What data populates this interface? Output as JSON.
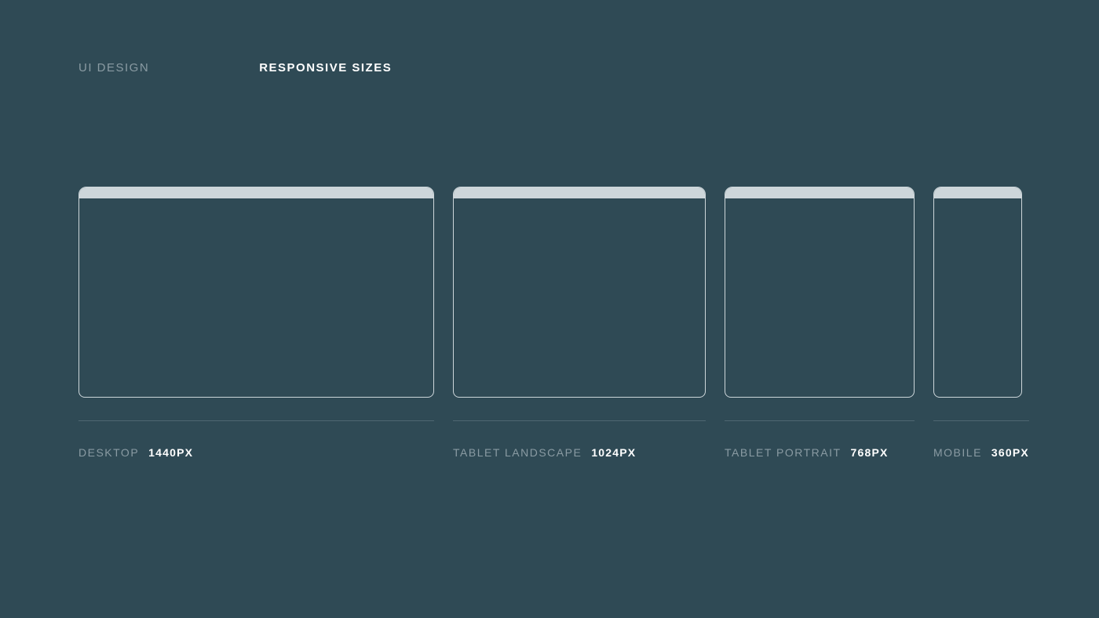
{
  "header": {
    "section": "UI DESIGN",
    "title": "RESPONSIVE SIZES"
  },
  "frames": [
    {
      "label": "DESKTOP",
      "value": "1440PX"
    },
    {
      "label": "TABLET LANDSCAPE",
      "value": "1024PX"
    },
    {
      "label": "TABLET PORTRAIT",
      "value": "768PX"
    },
    {
      "label": "MOBILE",
      "value": "360PX"
    }
  ]
}
